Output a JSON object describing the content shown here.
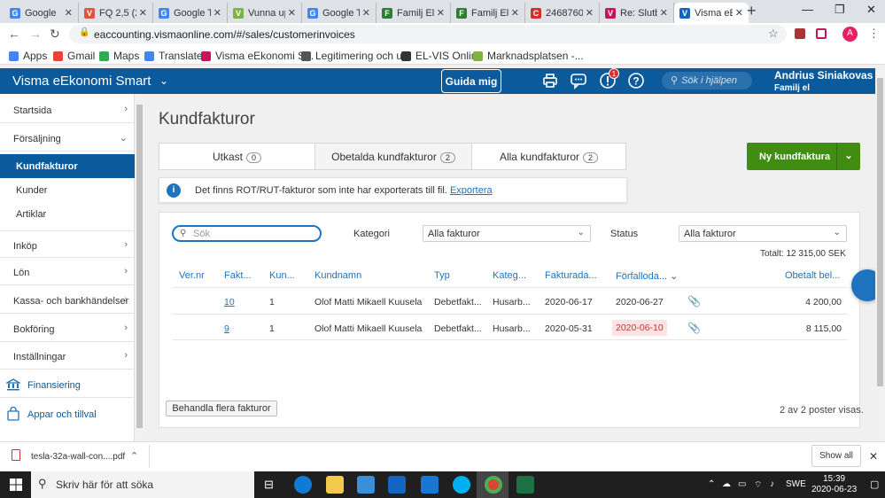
{
  "browser": {
    "tabs": [
      {
        "title": "Google",
        "color": "#4285f4",
        "glyph": "G"
      },
      {
        "title": "FQ 2,5 (2...",
        "color": "#e2533e",
        "glyph": "V"
      },
      {
        "title": "Google T",
        "color": "#4285f4",
        "glyph": "G"
      },
      {
        "title": "Vunna up",
        "color": "#7cb342",
        "glyph": "V"
      },
      {
        "title": "Google T",
        "color": "#4285f4",
        "glyph": "G"
      },
      {
        "title": "Familj El",
        "color": "#2e7d32",
        "glyph": "F"
      },
      {
        "title": "Familj El",
        "color": "#2e7d32",
        "glyph": "F"
      },
      {
        "title": "2468760",
        "color": "#d32f2f",
        "glyph": "C"
      },
      {
        "title": "Re: Slutb",
        "color": "#c2185b",
        "glyph": "V"
      },
      {
        "title": "Visma eE",
        "color": "#1565c0",
        "glyph": "V"
      }
    ],
    "url": "eaccounting.vismaonline.com/#/sales/customerinvoices",
    "bookmarks": [
      "Apps",
      "Gmail",
      "Maps",
      "Translate",
      "Visma eEkonomi S...",
      "Legitimering och u...",
      "EL-VIS Online",
      "Marknadsplatsen -..."
    ],
    "profile_initial": "A"
  },
  "header": {
    "brand": "Visma eEkonomi Smart",
    "guide_button": "Guida mig",
    "notification_count": "1",
    "help_search_placeholder": "Sök i hjälpen",
    "user_name": "Andrius Siniakovas",
    "company": "Familj el"
  },
  "sidebar": {
    "items": [
      {
        "label": "Startsida"
      },
      {
        "label": "Försäljning"
      },
      {
        "label": "Inköp"
      },
      {
        "label": "Lön"
      },
      {
        "label": "Kassa- och bankhändelser"
      },
      {
        "label": "Bokföring"
      },
      {
        "label": "Inställningar"
      },
      {
        "label": "Finansiering"
      },
      {
        "label": "Appar och tillval"
      }
    ],
    "sub_items": [
      {
        "label": "Kundfakturor"
      },
      {
        "label": "Kunder"
      },
      {
        "label": "Artiklar"
      }
    ]
  },
  "main": {
    "title": "Kundfakturor",
    "tabs": [
      {
        "label": "Utkast",
        "count": "0"
      },
      {
        "label": "Obetalda kundfakturor",
        "count": "2"
      },
      {
        "label": "Alla kundfakturor",
        "count": "2"
      }
    ],
    "new_invoice_button": "Ny kundfaktura",
    "info_message": "Det finns ROT/RUT-fakturor som inte har exporterats till fil.",
    "info_link": "Exportera",
    "search_placeholder": "Sök",
    "category_label": "Kategori",
    "category_value": "Alla fakturor",
    "status_label": "Status",
    "status_value": "Alla fakturor",
    "total": "Totalt: 12 315,00 SEK",
    "columns": [
      "Ver.nr",
      "Fakt...",
      "Kun...",
      "Kundnamn",
      "Typ",
      "Kateg...",
      "Fakturada...",
      "Förfalloda...",
      "Obetalt bel..."
    ],
    "rows": [
      {
        "ver": "",
        "invoice": "10",
        "customer_no": "1",
        "customer_name": "Olof Matti Mikaell Kuusela",
        "type": "Debetfakt...",
        "category": "Husarb...",
        "invoice_date": "2020-06-17",
        "due_date": "2020-06-27",
        "amount": "4 200,00",
        "overdue": false
      },
      {
        "ver": "",
        "invoice": "9",
        "customer_no": "1",
        "customer_name": "Olof Matti Mikaell Kuusela",
        "type": "Debetfakt...",
        "category": "Husarb...",
        "invoice_date": "2020-05-31",
        "due_date": "2020-06-10",
        "amount": "8 115,00",
        "overdue": true
      }
    ],
    "batch_button": "Behandla flera fakturor",
    "post_count": "2 av 2 poster visas."
  },
  "downloads": {
    "file": "tesla-32a-wall-con....pdf",
    "show_all": "Show all"
  },
  "taskbar": {
    "search_placeholder": "Skriv här för att söka",
    "language": "SWE",
    "time": "15:39",
    "date": "2020-06-23"
  }
}
